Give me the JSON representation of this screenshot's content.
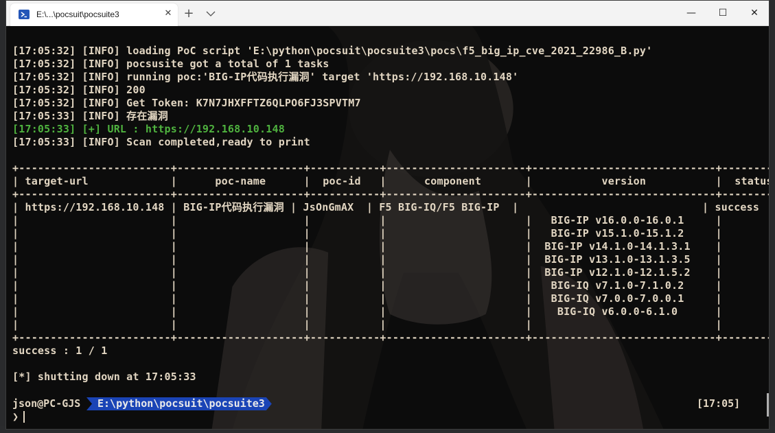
{
  "window": {
    "tab_title": "E:\\...\\pocsuit\\pocsuite3",
    "tab_icon": "powershell-icon",
    "close_tab_glyph": "✕",
    "new_tab_glyph": "+",
    "minimize_glyph": "—",
    "maximize_glyph": "☐",
    "close_glyph": "✕"
  },
  "terminal": {
    "lines": [
      {
        "text": "[17:05:32] [INFO] loading PoC script 'E:\\python\\pocsuit\\pocsuite3\\pocs\\f5_big_ip_cve_2021_22986_B.py'",
        "color": "normal"
      },
      {
        "text": "[17:05:32] [INFO] pocsusite got a total of 1 tasks",
        "color": "normal"
      },
      {
        "text": "[17:05:32] [INFO] running poc:'BIG-IP代码执行漏洞' target 'https://192.168.10.148'",
        "color": "normal"
      },
      {
        "text": "[17:05:32] [INFO] 200",
        "color": "normal"
      },
      {
        "text": "[17:05:32] [INFO] Get Token: K7N7JHXFFTZ6QLPO6FJ3SPVTM7",
        "color": "normal"
      },
      {
        "text": "[17:05:33] [INFO] 存在漏洞",
        "color": "normal"
      },
      {
        "text": "[17:05:33] [+] URL : https://192.168.10.148",
        "color": "green"
      },
      {
        "text": "[17:05:33] [INFO] Scan completed,ready to print",
        "color": "normal"
      },
      {
        "text": "",
        "color": "normal"
      },
      {
        "text": "+------------------------+--------------------+-----------+----------------------+-----------------------------+-----------+",
        "color": "normal"
      },
      {
        "text": "| target-url             |      poc-name      |  poc-id   |      component       |           version           |  status   |",
        "color": "normal"
      },
      {
        "text": "+------------------------+--------------------+-----------+----------------------+-----------------------------+-----------+",
        "color": "normal"
      },
      {
        "text": "| https://192.168.10.148 | BIG-IP代码执行漏洞 | JsOnGmAX  | F5 BIG-IQ/F5 BIG-IP  |                             | success   |",
        "color": "normal"
      },
      {
        "text": "|                        |                    |           |                      |   BIG-IP v16.0.0-16.0.1     |           |",
        "color": "normal"
      },
      {
        "text": "|                        |                    |           |                      |   BIG-IP v15.1.0-15.1.2     |           |",
        "color": "normal"
      },
      {
        "text": "|                        |                    |           |                      |  BIG-IP v14.1.0-14.1.3.1    |           |",
        "color": "normal"
      },
      {
        "text": "|                        |                    |           |                      |  BIG-IP v13.1.0-13.1.3.5    |           |",
        "color": "normal"
      },
      {
        "text": "|                        |                    |           |                      |  BIG-IP v12.1.0-12.1.5.2    |           |",
        "color": "normal"
      },
      {
        "text": "|                        |                    |           |                      |   BIG-IQ v7.1.0-7.1.0.2     |           |",
        "color": "normal"
      },
      {
        "text": "|                        |                    |           |                      |   BIG-IQ v7.0.0-7.0.0.1     |           |",
        "color": "normal"
      },
      {
        "text": "|                        |                    |           |                      |    BIG-IQ v6.0.0-6.1.0      |           |",
        "color": "normal"
      },
      {
        "text": "|                        |                    |           |                      |                             |           |",
        "color": "normal"
      },
      {
        "text": "+------------------------+--------------------+-----------+----------------------+-----------------------------+-----------+",
        "color": "normal"
      },
      {
        "text": "success : 1 / 1",
        "color": "normal"
      },
      {
        "text": "",
        "color": "normal"
      },
      {
        "text": "[*] shutting down at 17:05:33",
        "color": "normal"
      }
    ],
    "prompt": {
      "user": "json@PC-GJS",
      "path": "E:\\python\\pocsuit\\pocsuite3",
      "time": "[17:05]",
      "caret": "❯"
    }
  },
  "colors": {
    "text": "#e2d6c2",
    "green": "#4fb33f",
    "prompt_path_bg": "#1a44b6",
    "terminal_bg": "#0c0c0c"
  }
}
